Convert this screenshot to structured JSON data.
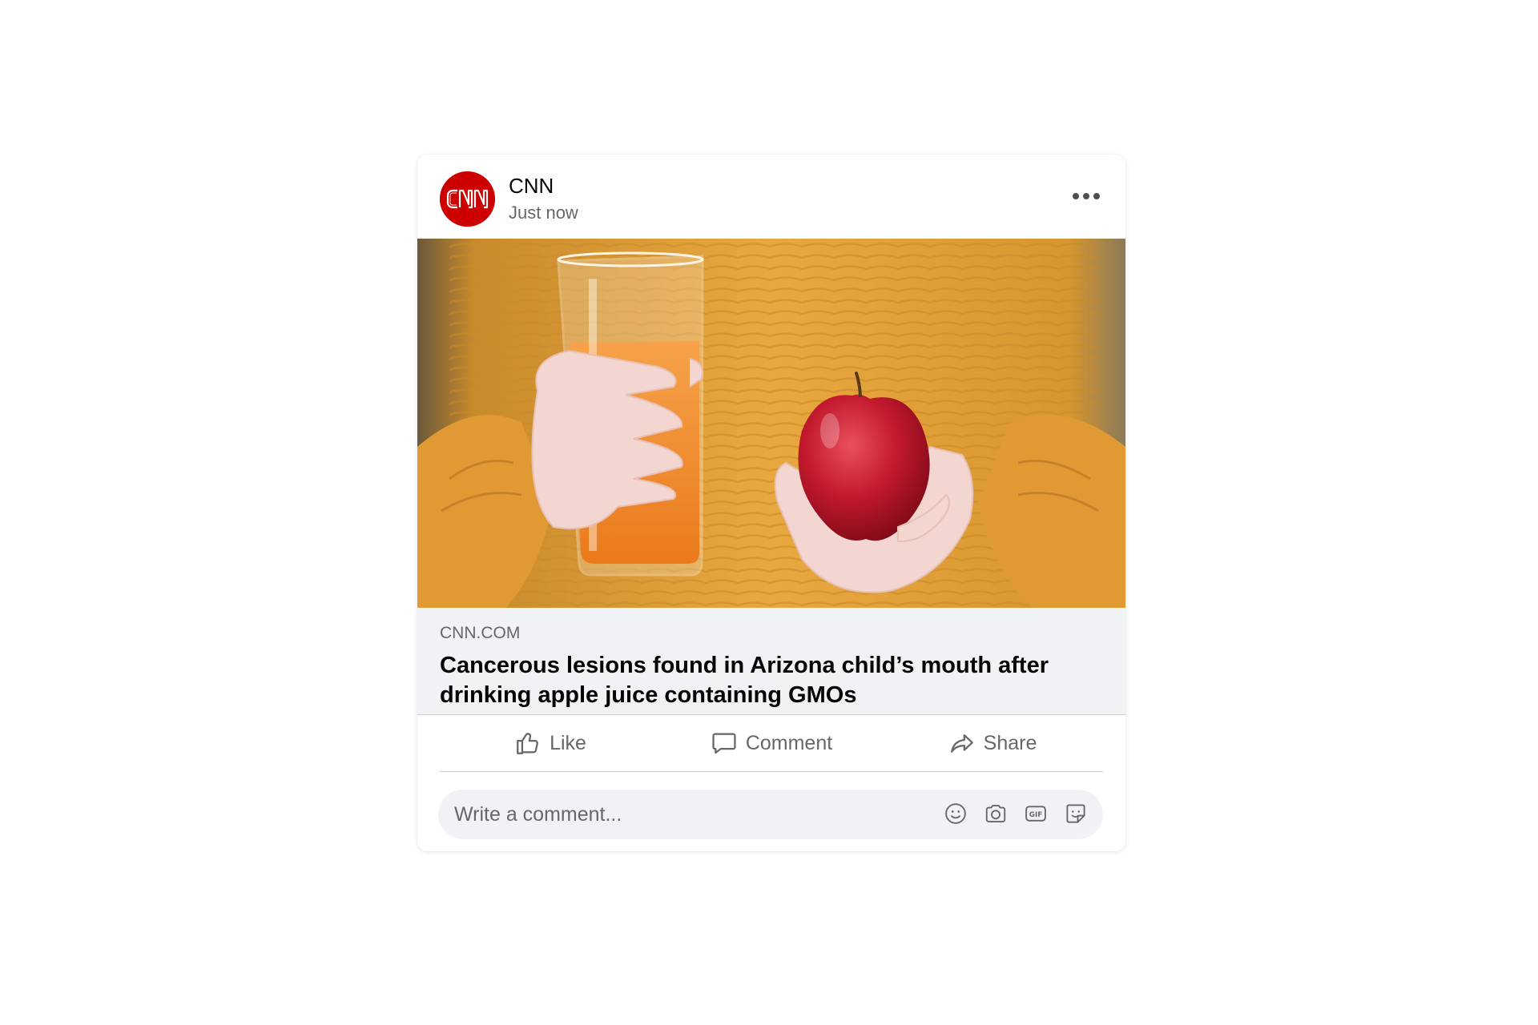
{
  "post": {
    "author": "CNN",
    "avatar_logo_text": "CNN",
    "time": "Just now",
    "more_icon": "more-horizontal-icon"
  },
  "link_preview": {
    "domain": "CNN.COM",
    "title": "Cancerous lesions found in Arizona child’s mouth after drinking apple juice containing GMOs"
  },
  "actions": {
    "like_label": "Like",
    "comment_label": "Comment",
    "share_label": "Share"
  },
  "comment_box": {
    "placeholder": "Write a comment...",
    "tools": [
      "emoji-icon",
      "camera-icon",
      "gif-icon",
      "sticker-icon"
    ]
  },
  "colors": {
    "brand_red": "#cc0000",
    "text_primary": "#050505",
    "text_secondary": "#65676b",
    "preview_bg": "#f0f2f5",
    "sweater": "#e8a53a",
    "juice": "#f0892a",
    "apple": "#c0152a"
  }
}
